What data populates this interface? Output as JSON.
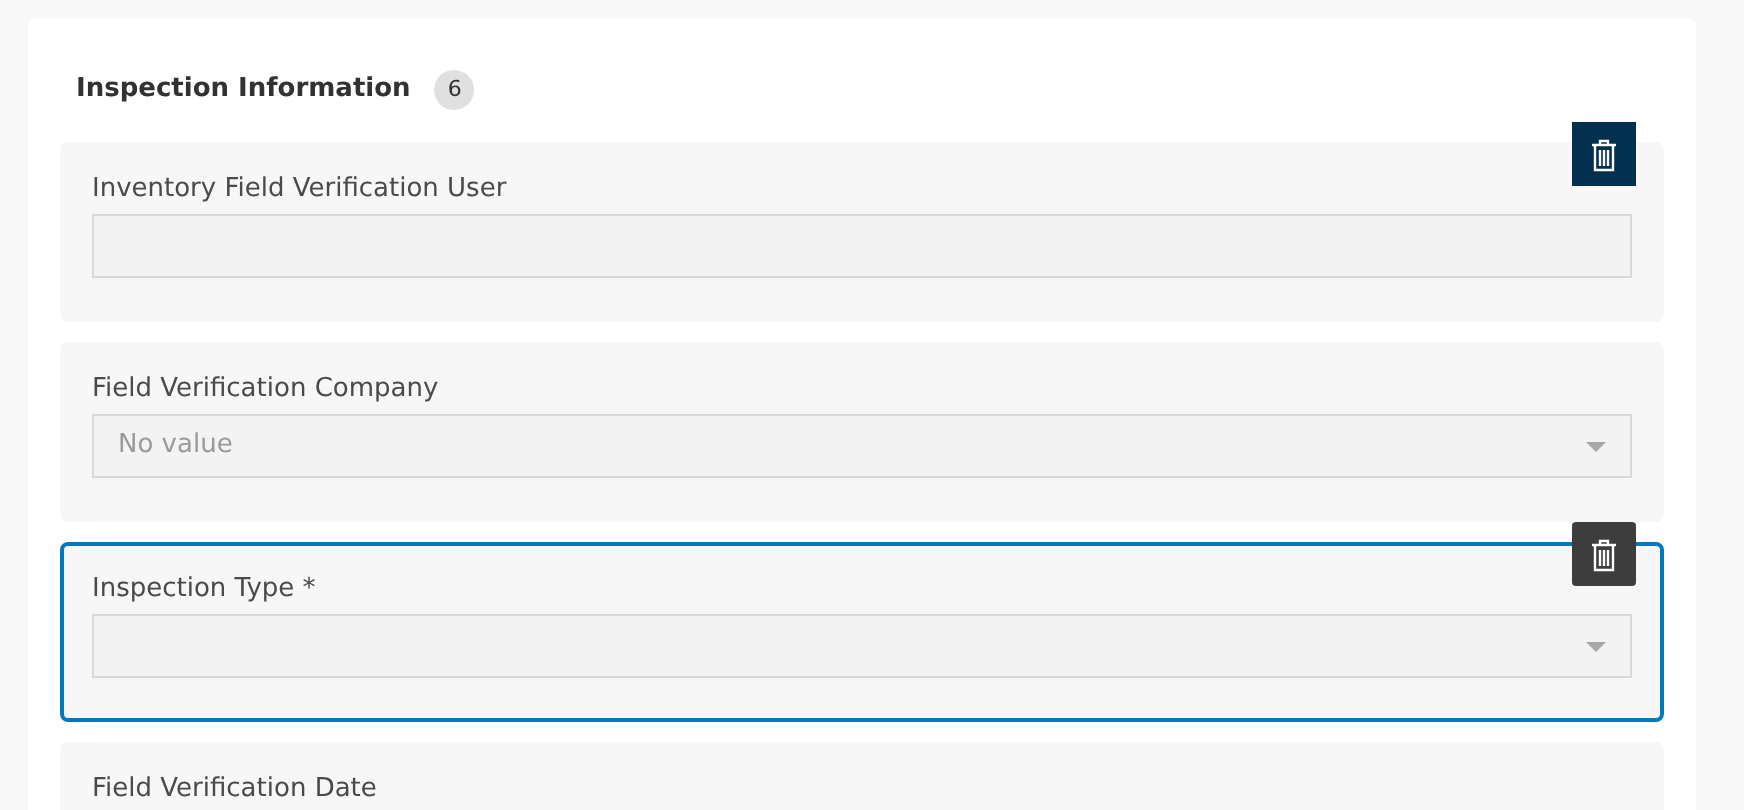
{
  "section": {
    "title": "Inspection Information",
    "count": "6"
  },
  "fields": [
    {
      "label": "Inventory Field Verification User",
      "kind": "text",
      "selected": false,
      "delete_button": {
        "highlighted": true
      }
    },
    {
      "label": "Field Verification Company",
      "kind": "select",
      "selected": false,
      "value": "No value"
    },
    {
      "label": "Inspection Type *",
      "kind": "select",
      "selected": true,
      "delete_button": {
        "highlighted": false
      }
    },
    {
      "label": "Field Verification Date",
      "selected": false
    }
  ]
}
